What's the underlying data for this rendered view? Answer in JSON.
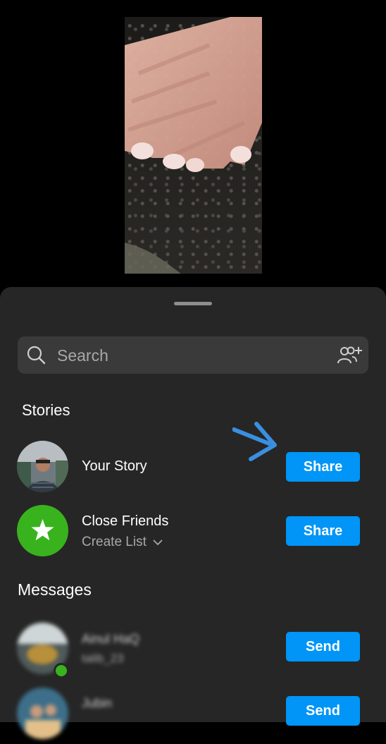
{
  "search": {
    "placeholder": "Search",
    "icon": "search-icon",
    "action_icon": "add-people-icon"
  },
  "stories": {
    "title": "Stories",
    "items": [
      {
        "name": "Your Story",
        "button": "Share"
      },
      {
        "name": "Close Friends",
        "subtitle": "Create List",
        "button": "Share",
        "icon": "star-icon",
        "color": "#39b31d"
      }
    ]
  },
  "messages": {
    "title": "Messages",
    "items": [
      {
        "name": "Ainul HaQ",
        "username": "talib_23",
        "button": "Send"
      },
      {
        "name": "Jubin",
        "button": "Send"
      }
    ]
  },
  "colors": {
    "accent": "#0095f6",
    "sheet": "#262626",
    "annotation_arrow": "#3a8fe0"
  }
}
